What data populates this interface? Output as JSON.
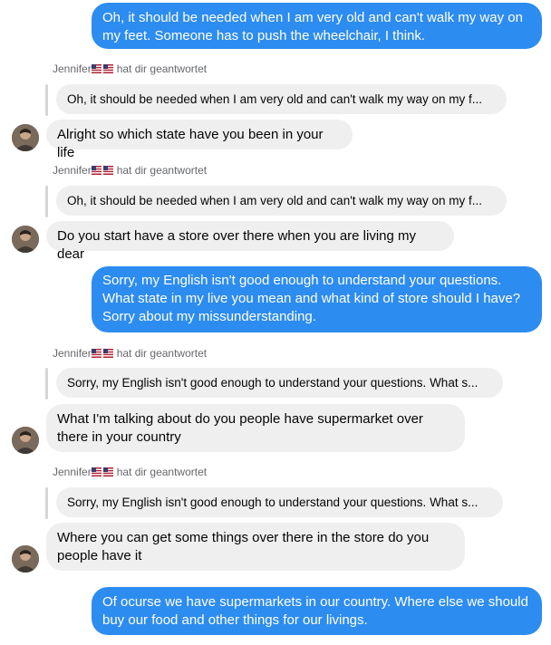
{
  "contact_name": "Jennifer",
  "reply_suffix": "hat dir geantwortet",
  "colors": {
    "outgoing": "#2d8cf0",
    "incoming": "#efefef",
    "meta": "#65676b"
  },
  "messages": [
    {
      "dir": "out",
      "text": "Oh, it should be needed when I am very old and can't walk my way on my feet. Someone has to push the wheelchair, I think."
    },
    {
      "dir": "reply",
      "quote": "Oh, it should be needed when I am very old and can't walk my way on my f..."
    },
    {
      "dir": "in",
      "text": "Alright so which state have you been in your life"
    },
    {
      "dir": "reply",
      "quote": "Oh, it should be needed when I am very old and can't walk my way on my f..."
    },
    {
      "dir": "in",
      "text": "Do you start have a store over there when you are living my dear"
    },
    {
      "dir": "out",
      "text": "Sorry, my English isn't good enough to understand your questions. What state in my live you mean and what kind of store should I have? Sorry about my missunderstanding."
    },
    {
      "dir": "reply",
      "quote": "Sorry, my English isn't good enough to understand your questions. What s..."
    },
    {
      "dir": "in",
      "text": "What I'm talking about do you people have supermarket over there in your country"
    },
    {
      "dir": "reply",
      "quote": "Sorry, my English isn't good enough to understand your questions. What s..."
    },
    {
      "dir": "in",
      "text": "Where you can get some things over there in the store do you people have it"
    },
    {
      "dir": "out",
      "text": "Of ocurse we have supermarkets in our country. Where else we should buy our food and other things for our livings."
    }
  ]
}
